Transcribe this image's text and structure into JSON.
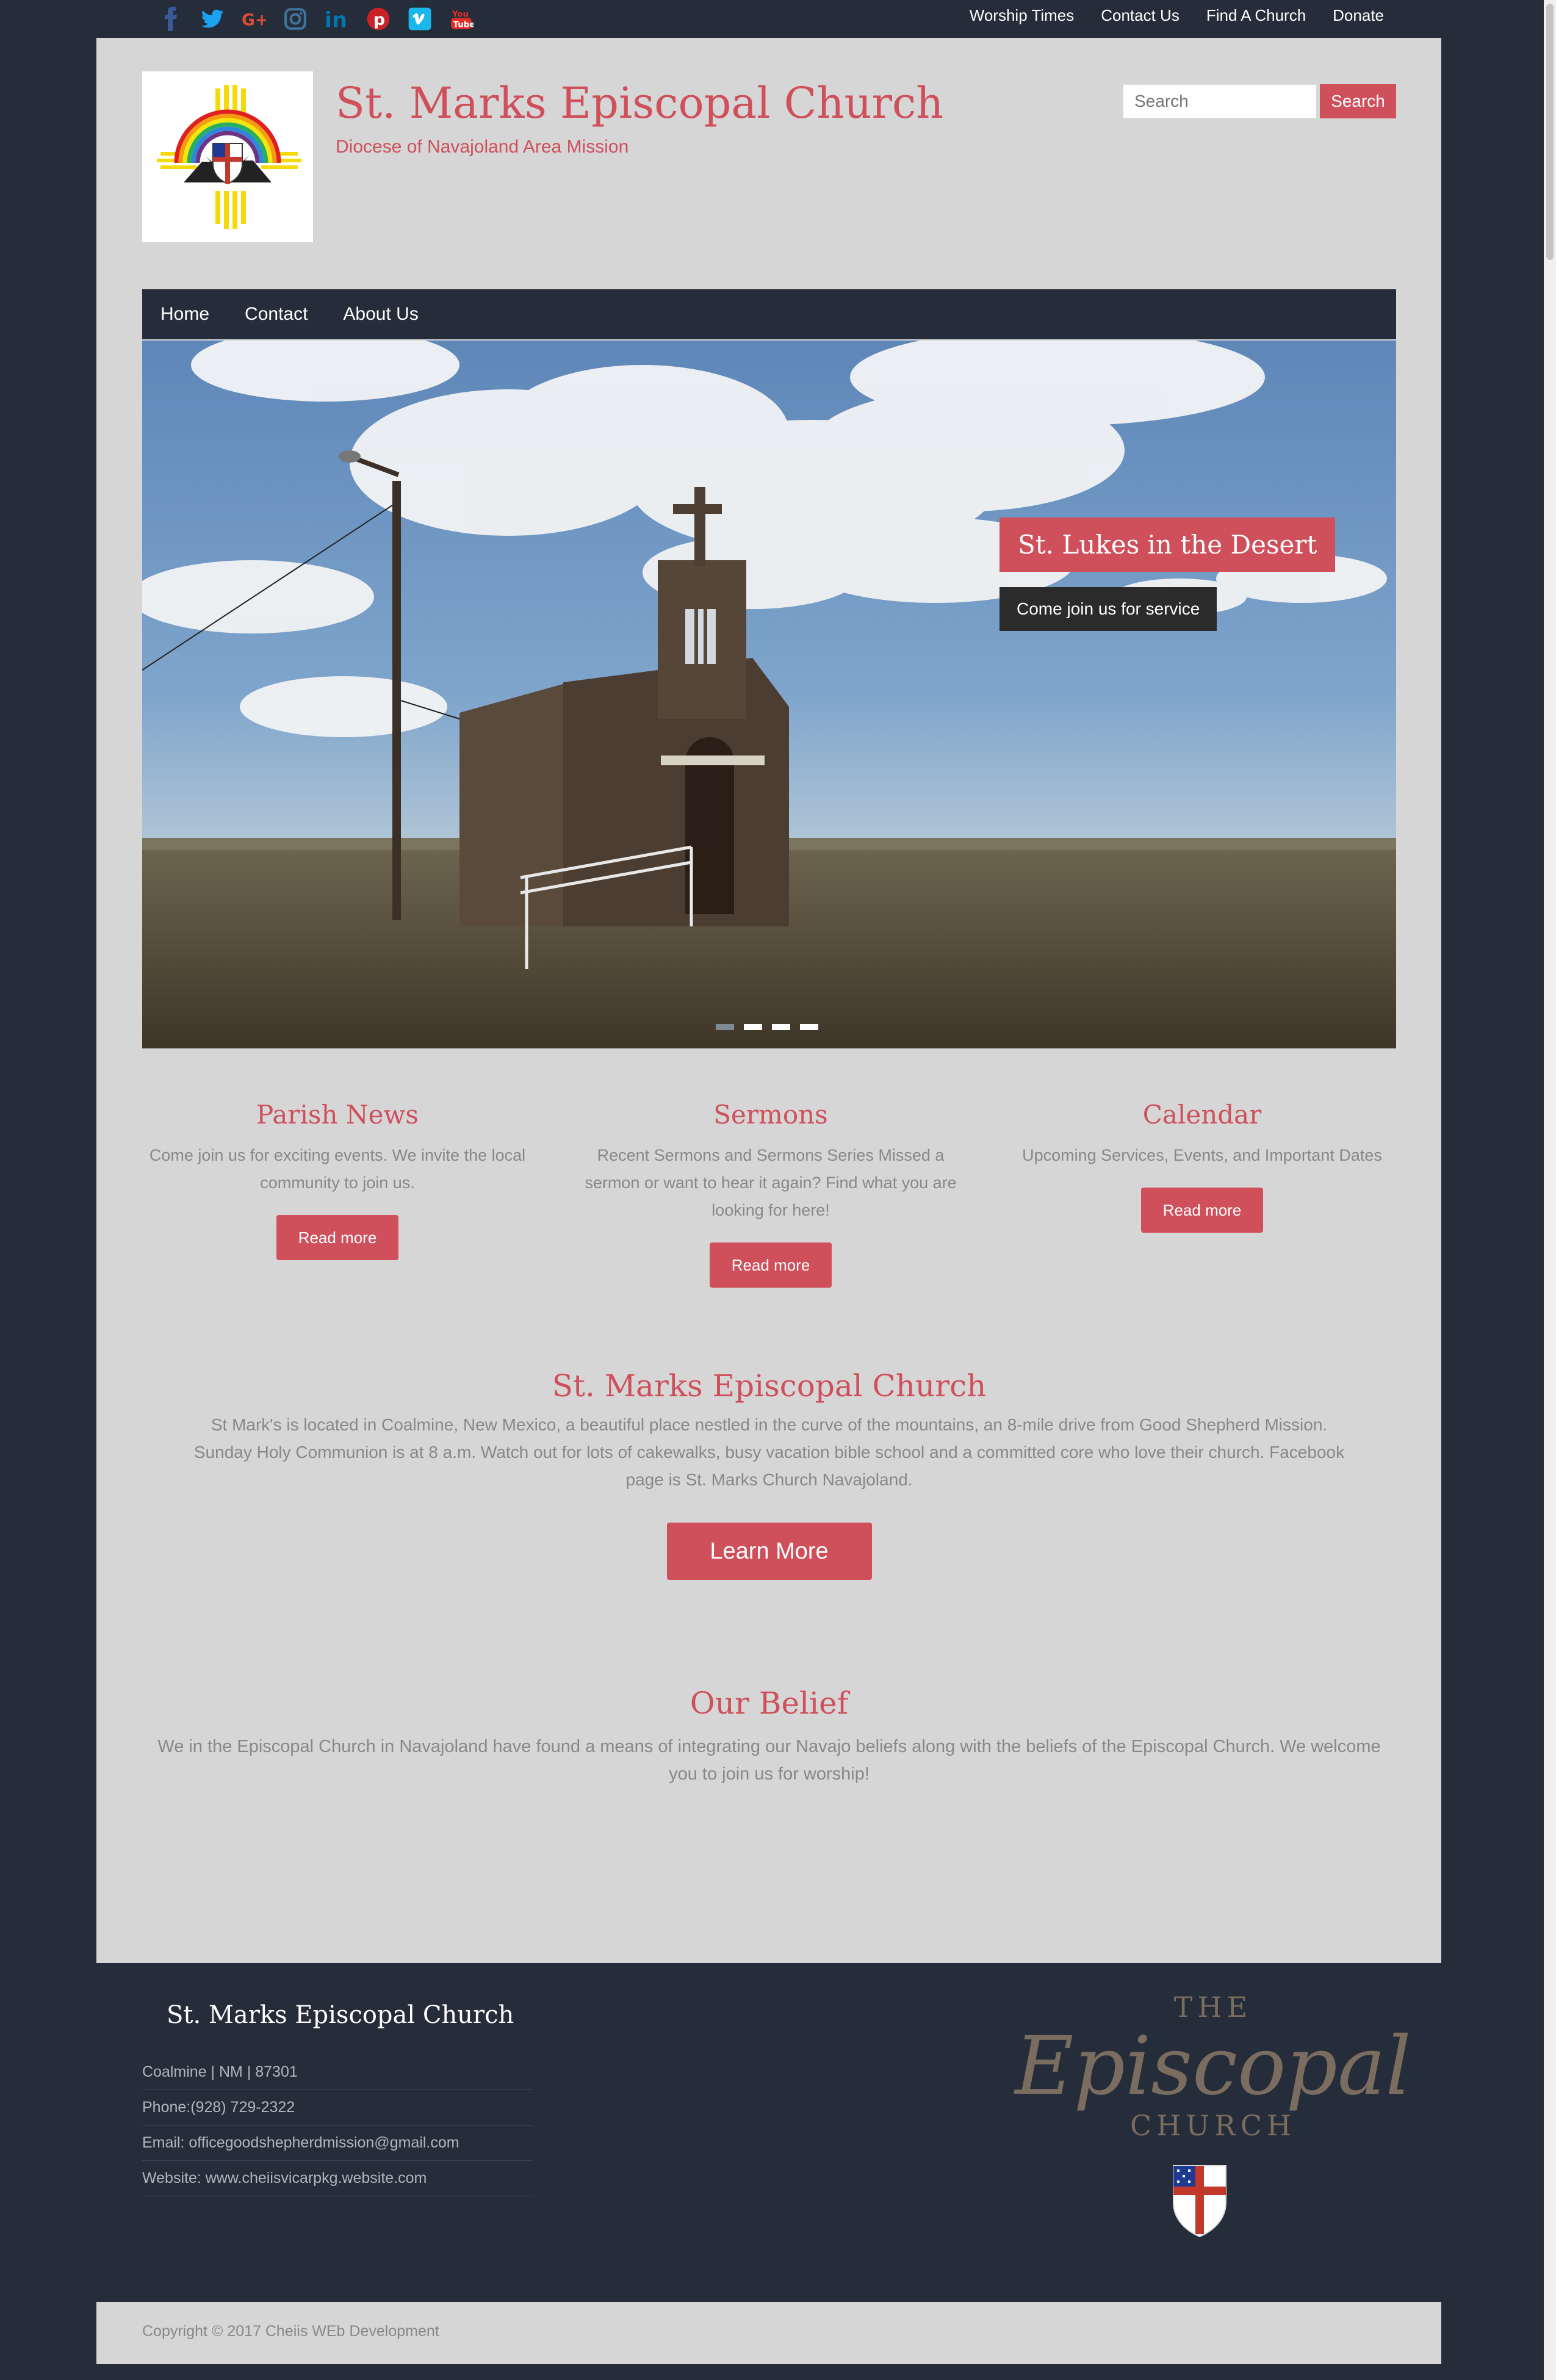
{
  "topbar": {
    "social": [
      {
        "name": "facebook-icon",
        "color": "#3b5998"
      },
      {
        "name": "twitter-icon",
        "color": "#1da1f2"
      },
      {
        "name": "google-plus-icon",
        "color": "#dd4b39"
      },
      {
        "name": "instagram-icon",
        "color": "#3f729b"
      },
      {
        "name": "linkedin-icon",
        "color": "#0077b5"
      },
      {
        "name": "pinterest-icon",
        "color": "#cb2027"
      },
      {
        "name": "vimeo-icon",
        "color": "#1ab7ea"
      },
      {
        "name": "youtube-icon",
        "color": "#e52d27"
      }
    ],
    "links": [
      "Worship Times",
      "Contact Us",
      "Find A Church",
      "Donate"
    ]
  },
  "header": {
    "title": "St. Marks Episcopal Church",
    "tagline": "Diocese of Navajoland Area Mission"
  },
  "search": {
    "placeholder": "Search",
    "button": "Search"
  },
  "nav": [
    "Home",
    "Contact",
    "About Us"
  ],
  "slider": {
    "title": "St. Lukes in the Desert",
    "subtitle": "Come join us for service",
    "slide_count": 4,
    "active_slide": 1
  },
  "features": [
    {
      "title": "Parish News",
      "text": "Come join us for exciting events. We invite the local community to join us.",
      "button": "Read more"
    },
    {
      "title": "Sermons",
      "text": "Recent Sermons and Sermons Series Missed a sermon or want to hear it again? Find what you are looking for here!",
      "button": "Read more"
    },
    {
      "title": "Calendar",
      "text": "Upcoming Services, Events, and Important Dates",
      "button": "Read more"
    }
  ],
  "about": {
    "title": "St. Marks Episcopal Church",
    "text": "St Mark's is located in Coalmine, New Mexico, a beautiful place nestled in the curve of the mountains, an 8-mile drive from Good Shepherd Mission. Sunday Holy Communion is at 8 a.m. Watch out for lots of cakewalks, busy vacation bible school and a committed core who love their church. Facebook page is St. Marks Church Navajoland.",
    "button": "Learn More"
  },
  "belief": {
    "title": "Our Belief",
    "text": "We in the Episcopal Church in Navajoland have found a means of integrating our Navajo beliefs along with the beliefs of the Episcopal Church. We welcome you to join us for worship!"
  },
  "footer": {
    "title": "St. Marks Episcopal Church",
    "info": [
      "Coalmine | NM | 87301",
      "Phone:(928) 729-2322",
      "Email: officegoodshepherdmission@gmail.com",
      "Website: www.cheiisvicarpkg.website.com"
    ],
    "brand_the": "THE",
    "brand_main": "Episcopal",
    "brand_church": "CHURCH"
  },
  "copyright": "Copyright © 2017 Cheiis WEb Development",
  "colors": {
    "accent": "#cf4f5b",
    "dark": "#252d3a",
    "panel": "#d6d6d6"
  }
}
